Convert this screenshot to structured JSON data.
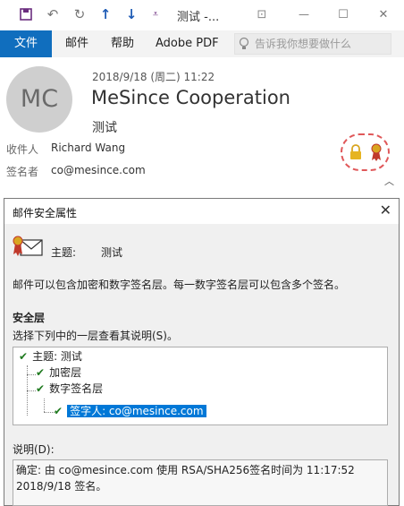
{
  "window": {
    "title": "测试  -...",
    "quick_access": [
      {
        "name": "save-icon",
        "glyph": "▣",
        "color": "#6b2d7e"
      },
      {
        "name": "undo-icon",
        "glyph": "↶",
        "color": "#777777"
      },
      {
        "name": "redo-icon",
        "glyph": "↷",
        "color": "#777777"
      },
      {
        "name": "up-arrow-icon",
        "glyph": "↑",
        "color": "#1e5bb5"
      },
      {
        "name": "down-arrow-icon",
        "glyph": "↓",
        "color": "#1e5bb5"
      },
      {
        "name": "customize-icon",
        "glyph": "⇟",
        "color": "#6b2d7e"
      }
    ],
    "controls": {
      "restore": "⊡",
      "minimize": "—",
      "maximize": "☐",
      "close": "✕"
    }
  },
  "ribbon": {
    "file_tab": "文件",
    "tabs": [
      "邮件",
      "帮助",
      "Adobe PDF"
    ],
    "tell_me_placeholder": "告诉我你想要做什么",
    "accent": "#106ebe"
  },
  "message": {
    "avatar_initials": "MC",
    "date": "2018/9/18 (周二) 11:22",
    "from": "MeSince Cooperation",
    "subject": "测试",
    "recipient_label": "收件人",
    "recipient": "Richard Wang",
    "signer_label": "签名者",
    "signer": "co@mesince.com",
    "security_icons": [
      "lock-icon",
      "certificate-ribbon-icon"
    ]
  },
  "dialog": {
    "title": "邮件安全属性",
    "subject_label": "主题:",
    "subject_value": "测试",
    "description": "邮件可以包含加密和数字签名层。每一数字签名层可以包含多个签名。",
    "security_layer_heading": "安全层",
    "instruction": "选择下列中的一层查看其说明(S)。",
    "layers": [
      {
        "label": "主题: 测试",
        "checked": true,
        "level": 0
      },
      {
        "label": "加密层",
        "checked": true,
        "level": 1
      },
      {
        "label": "数字签名层",
        "checked": true,
        "level": 1
      },
      {
        "label": "签字人: co@mesince.com",
        "checked": true,
        "level": 2,
        "selected": true
      }
    ],
    "explanation_label": "说明(D):",
    "explanation_line1": "确定: 由 co@mesince.com 使用 RSA/SHA256签名时间为 11:17:52",
    "explanation_line2": "2018/9/18 签名。"
  }
}
